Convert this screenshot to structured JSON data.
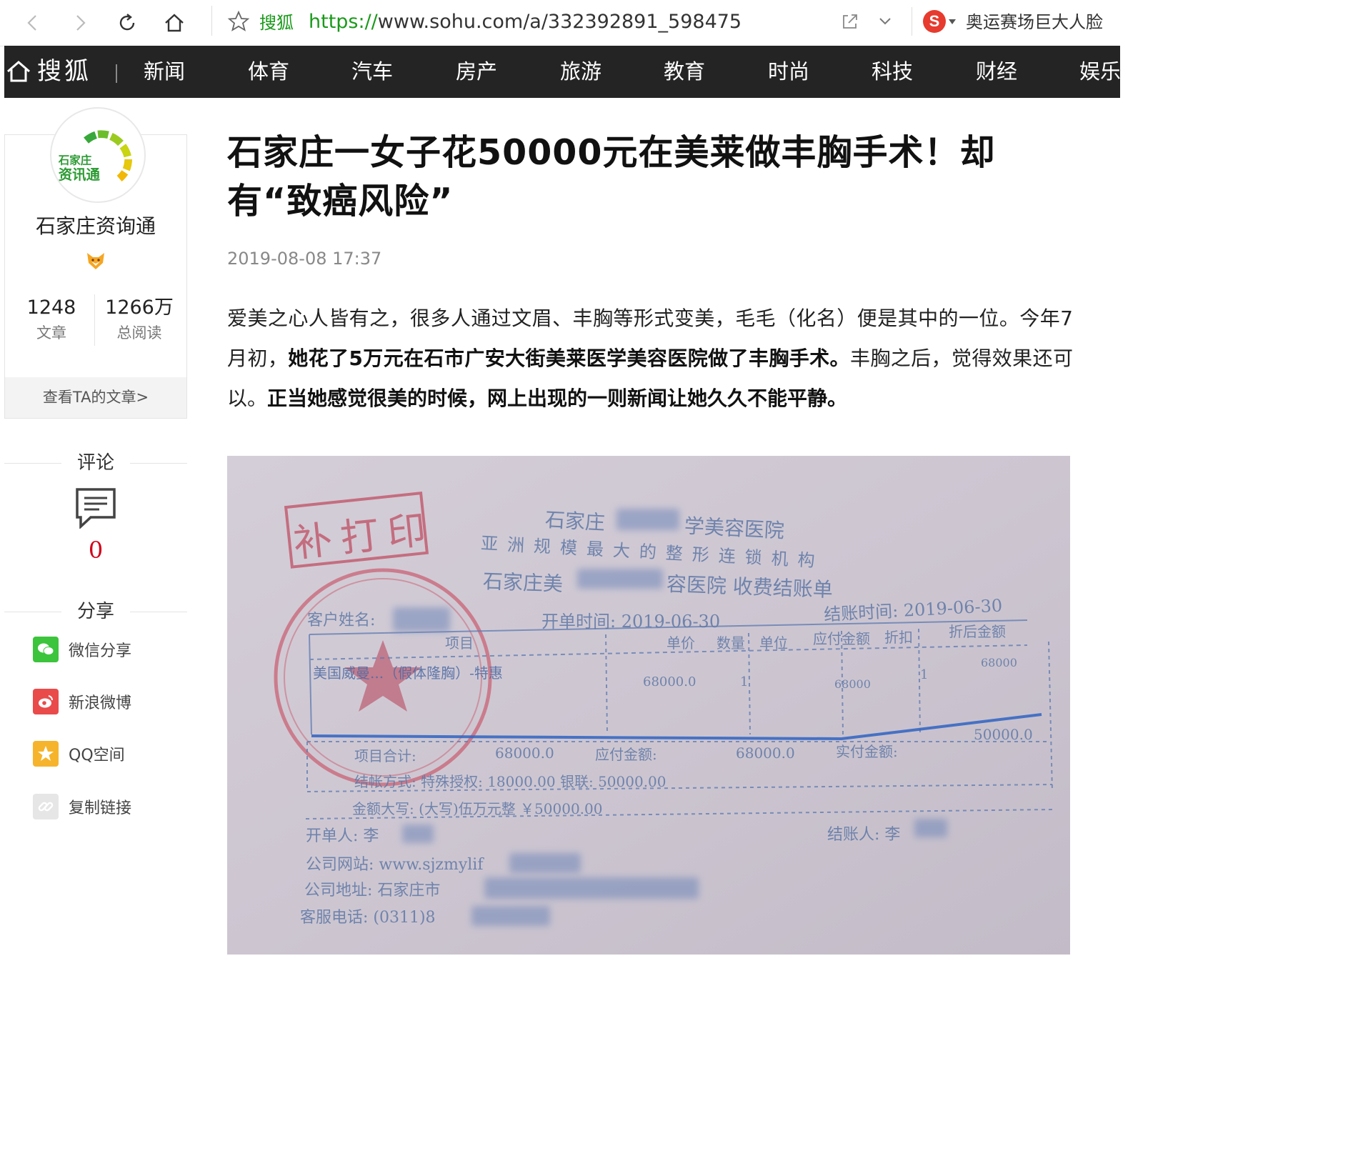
{
  "browser": {
    "site_name": "搜狐",
    "url_scheme": "https://",
    "url_rest": "www.sohu.com/a/332392891_598475",
    "search_engine_letter": "S",
    "hot_search": "奥运赛场巨大人脸"
  },
  "channel_nav": {
    "logo": "搜狐",
    "items": [
      "新闻",
      "体育",
      "汽车",
      "房产",
      "旅游",
      "教育",
      "时尚",
      "科技",
      "财经",
      "娱乐"
    ]
  },
  "author": {
    "avatar_text_line1": "石家庄",
    "avatar_text_line2": "资讯通",
    "name": "石家庄资询通",
    "articles_count": "1248",
    "articles_label": "文章",
    "reads_count": "1266万",
    "reads_label": "总阅读",
    "see_articles": "查看TA的文章>"
  },
  "sidebar": {
    "comment_title": "评论",
    "comment_count": "0",
    "share_title": "分享",
    "share_items": [
      {
        "label": "微信分享",
        "color": "#3cc43c"
      },
      {
        "label": "新浪微博",
        "color": "#e94b4b"
      },
      {
        "label": "QQ空间",
        "color": "#f6b42c"
      },
      {
        "label": "复制链接",
        "color": "#cfcfcf"
      }
    ]
  },
  "article": {
    "title": "石家庄一女子花50000元在美莱做丰胸手术！却有“致癌风险”",
    "date": "2019-08-08 17:37",
    "p1_a": "爱美之心人皆有之，很多人通过文眉、丰胸等形式变美，毛毛（化名）便是其中的一位。今年7月初，",
    "p1_b": "她花了5万元在石市广安大街美莱医学美容医院做了丰胸手术。",
    "p1_c": "丰胸之后，觉得效果还可以。",
    "p1_d": "正当她感觉很美的时候，网上出现的一则新闻让她久久不能平静。"
  },
  "receipt": {
    "reprint_stamp": "补打印",
    "hospital_line1": "石家庄",
    "hospital_line1b": "学美容医院",
    "chain_line": "亚洲规模最大的整形连锁机构",
    "hospital_line2a": "石家庄美",
    "hospital_line2b": "容医院 收费结账单",
    "customer_label": "客户姓名:",
    "order_time": "开单时间: 2019-06-30",
    "settle_time": "结账时间: 2019-06-30",
    "col_item": "项目",
    "col_price": "单价",
    "col_qty": "数量",
    "col_unit": "单位",
    "col_amount": "应付金额",
    "col_discount": "折扣",
    "col_due": "折后金额",
    "row_item": "美国威曼...（假体隆胸）-特惠",
    "row_price": "68000.0",
    "row_qty": "1",
    "row_amount": "68000",
    "row_discount": "1",
    "row_due": "68000",
    "total_label": "项目合计:",
    "total_value": "68000.0",
    "payable_label": "应付金额:",
    "payable_value": "68000.0",
    "paid_label": "实付金额:",
    "paid_value": "50000.0",
    "method_line": "结帐方式: 特殊授权: 18000.00 银联: 50000.00",
    "amount_words": "金额大写: (大写)伍万元整 ￥50000.00",
    "issuer": "开单人: 李",
    "cashier": "结账人: 李",
    "website": "公司网站: www.sjzmylif",
    "address": "公司地址: 石家庄市",
    "phone": "客服电话: (0311)8"
  }
}
